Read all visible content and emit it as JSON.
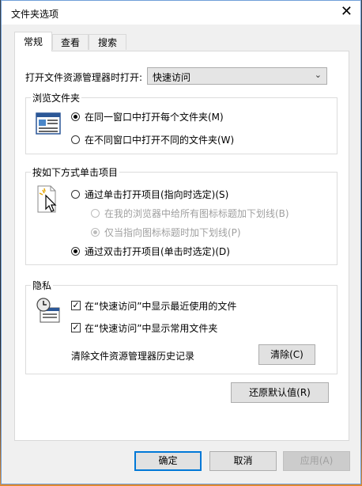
{
  "window": {
    "title": "文件夹选项",
    "close_glyph": "✕"
  },
  "tabs": [
    {
      "label": "常规",
      "active": true
    },
    {
      "label": "查看",
      "active": false
    },
    {
      "label": "搜索",
      "active": false
    }
  ],
  "open_explorer": {
    "label": "打开文件资源管理器时打开:",
    "value": "快速访问"
  },
  "browse_folders": {
    "title": "浏览文件夹",
    "options": [
      {
        "label": "在同一窗口中打开每个文件夹(M)",
        "selected": true
      },
      {
        "label": "在不同窗口中打开不同的文件夹(W)",
        "selected": false
      }
    ]
  },
  "click_items": {
    "title": "按如下方式单击项目",
    "single": {
      "label": "通过单击打开项目(指向时选定)(S)",
      "selected": false
    },
    "underline_all": {
      "label": "在我的浏览器中给所有图标标题加下划线(B)",
      "selected": false,
      "disabled": true
    },
    "underline_hover": {
      "label": "仅当指向图标标题时加下划线(P)",
      "selected": true,
      "disabled": true
    },
    "double": {
      "label": "通过双击打开项目(单击时选定)(D)",
      "selected": true
    }
  },
  "privacy": {
    "title": "隐私",
    "recent_files": {
      "label": "在“快速访问”中显示最近使用的文件",
      "checked": true
    },
    "frequent_folders": {
      "label": "在“快速访问”中显示常用文件夹",
      "checked": true
    },
    "clear_history_label": "清除文件资源管理器历史记录",
    "clear_button": "清除(C)"
  },
  "restore_defaults_button": "还原默认值(R)",
  "footer": {
    "ok": "确定",
    "cancel": "取消",
    "apply": "应用(A)"
  },
  "check_glyph": "✓",
  "chevron_glyph": "⌄"
}
